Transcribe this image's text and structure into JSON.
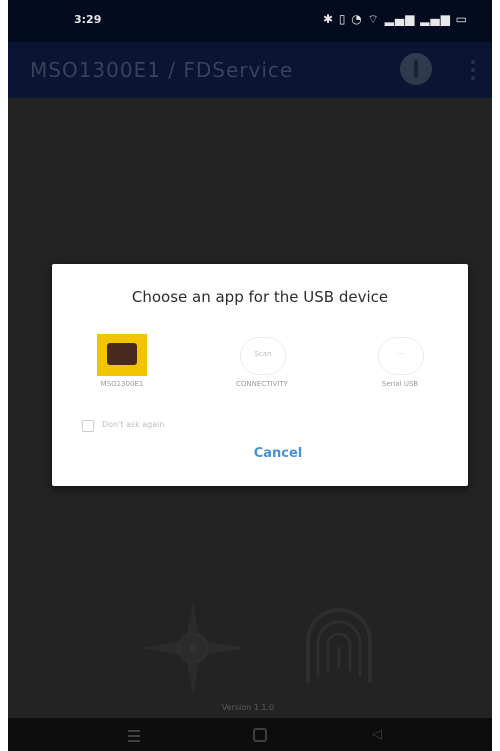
{
  "status_bar": {
    "time": "3:29",
    "icons": "✱ ▯ ◔ ⌔ ▂▄▆ ▂▄▆ ▭"
  },
  "app_bar": {
    "title": "MSO1300E1 / FDService"
  },
  "dialog": {
    "title": "Choose an app for the USB device",
    "apps": [
      {
        "label": "MSO1300E1"
      },
      {
        "label": "CONNECTIVITY",
        "icon_text": "Scan"
      },
      {
        "label": "Serial USB",
        "icon_text": "···"
      }
    ],
    "checkbox_label": "Don't ask again",
    "cancel_label": "Cancel"
  },
  "footer": {
    "version": "Version 1.1.0"
  },
  "colors": {
    "accent": "#4a90d9",
    "app_icon_bg": "#f2c400"
  }
}
